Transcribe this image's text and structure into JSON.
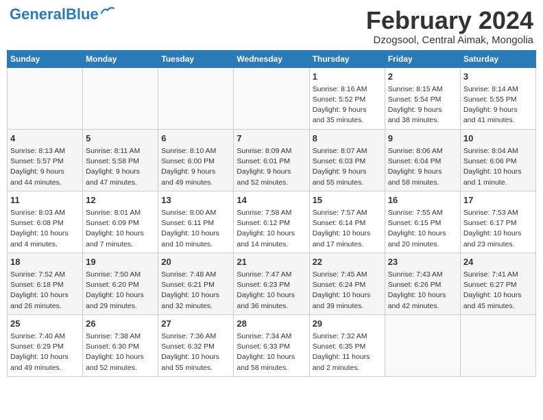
{
  "header": {
    "logo_general": "General",
    "logo_blue": "Blue",
    "month_year": "February 2024",
    "location": "Dzogsool, Central Aimak, Mongolia"
  },
  "days_of_week": [
    "Sunday",
    "Monday",
    "Tuesday",
    "Wednesday",
    "Thursday",
    "Friday",
    "Saturday"
  ],
  "weeks": [
    [
      {
        "day": "",
        "info": ""
      },
      {
        "day": "",
        "info": ""
      },
      {
        "day": "",
        "info": ""
      },
      {
        "day": "",
        "info": ""
      },
      {
        "day": "1",
        "info": "Sunrise: 8:16 AM\nSunset: 5:52 PM\nDaylight: 9 hours\nand 35 minutes."
      },
      {
        "day": "2",
        "info": "Sunrise: 8:15 AM\nSunset: 5:54 PM\nDaylight: 9 hours\nand 38 minutes."
      },
      {
        "day": "3",
        "info": "Sunrise: 8:14 AM\nSunset: 5:55 PM\nDaylight: 9 hours\nand 41 minutes."
      }
    ],
    [
      {
        "day": "4",
        "info": "Sunrise: 8:13 AM\nSunset: 5:57 PM\nDaylight: 9 hours\nand 44 minutes."
      },
      {
        "day": "5",
        "info": "Sunrise: 8:11 AM\nSunset: 5:58 PM\nDaylight: 9 hours\nand 47 minutes."
      },
      {
        "day": "6",
        "info": "Sunrise: 8:10 AM\nSunset: 6:00 PM\nDaylight: 9 hours\nand 49 minutes."
      },
      {
        "day": "7",
        "info": "Sunrise: 8:09 AM\nSunset: 6:01 PM\nDaylight: 9 hours\nand 52 minutes."
      },
      {
        "day": "8",
        "info": "Sunrise: 8:07 AM\nSunset: 6:03 PM\nDaylight: 9 hours\nand 55 minutes."
      },
      {
        "day": "9",
        "info": "Sunrise: 8:06 AM\nSunset: 6:04 PM\nDaylight: 9 hours\nand 58 minutes."
      },
      {
        "day": "10",
        "info": "Sunrise: 8:04 AM\nSunset: 6:06 PM\nDaylight: 10 hours\nand 1 minute."
      }
    ],
    [
      {
        "day": "11",
        "info": "Sunrise: 8:03 AM\nSunset: 6:08 PM\nDaylight: 10 hours\nand 4 minutes."
      },
      {
        "day": "12",
        "info": "Sunrise: 8:01 AM\nSunset: 6:09 PM\nDaylight: 10 hours\nand 7 minutes."
      },
      {
        "day": "13",
        "info": "Sunrise: 8:00 AM\nSunset: 6:11 PM\nDaylight: 10 hours\nand 10 minutes."
      },
      {
        "day": "14",
        "info": "Sunrise: 7:58 AM\nSunset: 6:12 PM\nDaylight: 10 hours\nand 14 minutes."
      },
      {
        "day": "15",
        "info": "Sunrise: 7:57 AM\nSunset: 6:14 PM\nDaylight: 10 hours\nand 17 minutes."
      },
      {
        "day": "16",
        "info": "Sunrise: 7:55 AM\nSunset: 6:15 PM\nDaylight: 10 hours\nand 20 minutes."
      },
      {
        "day": "17",
        "info": "Sunrise: 7:53 AM\nSunset: 6:17 PM\nDaylight: 10 hours\nand 23 minutes."
      }
    ],
    [
      {
        "day": "18",
        "info": "Sunrise: 7:52 AM\nSunset: 6:18 PM\nDaylight: 10 hours\nand 26 minutes."
      },
      {
        "day": "19",
        "info": "Sunrise: 7:50 AM\nSunset: 6:20 PM\nDaylight: 10 hours\nand 29 minutes."
      },
      {
        "day": "20",
        "info": "Sunrise: 7:48 AM\nSunset: 6:21 PM\nDaylight: 10 hours\nand 32 minutes."
      },
      {
        "day": "21",
        "info": "Sunrise: 7:47 AM\nSunset: 6:23 PM\nDaylight: 10 hours\nand 36 minutes."
      },
      {
        "day": "22",
        "info": "Sunrise: 7:45 AM\nSunset: 6:24 PM\nDaylight: 10 hours\nand 39 minutes."
      },
      {
        "day": "23",
        "info": "Sunrise: 7:43 AM\nSunset: 6:26 PM\nDaylight: 10 hours\nand 42 minutes."
      },
      {
        "day": "24",
        "info": "Sunrise: 7:41 AM\nSunset: 6:27 PM\nDaylight: 10 hours\nand 45 minutes."
      }
    ],
    [
      {
        "day": "25",
        "info": "Sunrise: 7:40 AM\nSunset: 6:29 PM\nDaylight: 10 hours\nand 49 minutes."
      },
      {
        "day": "26",
        "info": "Sunrise: 7:38 AM\nSunset: 6:30 PM\nDaylight: 10 hours\nand 52 minutes."
      },
      {
        "day": "27",
        "info": "Sunrise: 7:36 AM\nSunset: 6:32 PM\nDaylight: 10 hours\nand 55 minutes."
      },
      {
        "day": "28",
        "info": "Sunrise: 7:34 AM\nSunset: 6:33 PM\nDaylight: 10 hours\nand 58 minutes."
      },
      {
        "day": "29",
        "info": "Sunrise: 7:32 AM\nSunset: 6:35 PM\nDaylight: 11 hours\nand 2 minutes."
      },
      {
        "day": "",
        "info": ""
      },
      {
        "day": "",
        "info": ""
      }
    ]
  ]
}
